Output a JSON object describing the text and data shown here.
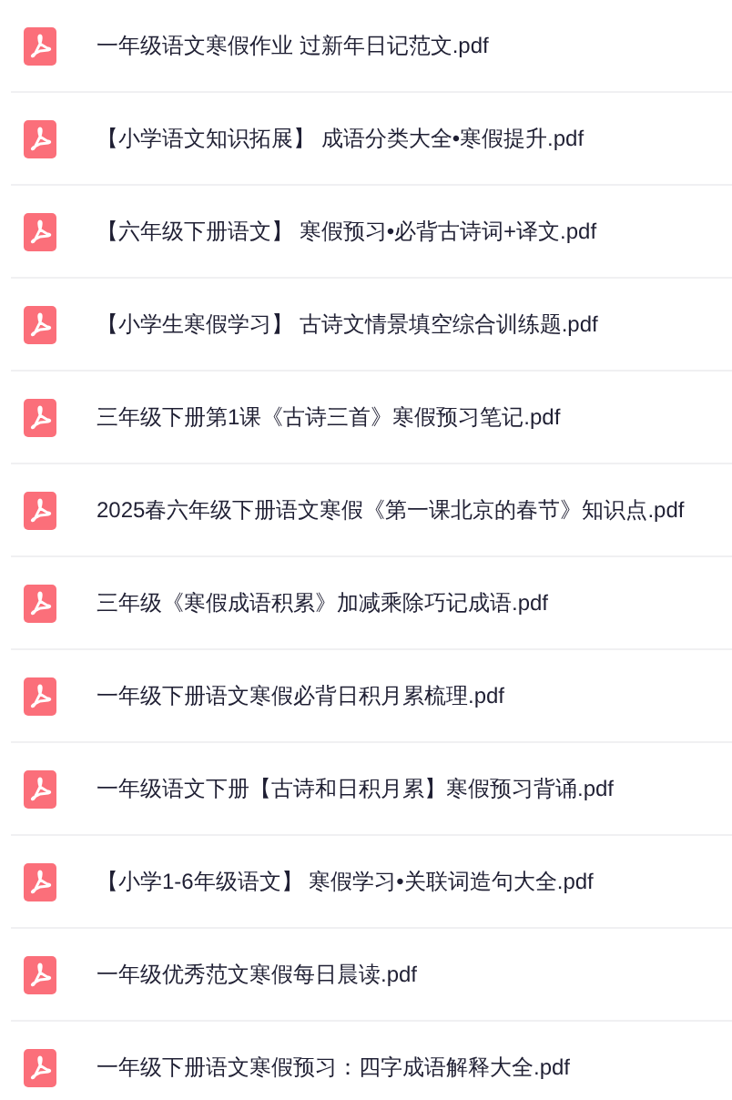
{
  "files": [
    {
      "name": "一年级语文寒假作业 过新年日记范文.pdf"
    },
    {
      "name": "【小学语文知识拓展】 成语分类大全•寒假提升.pdf"
    },
    {
      "name": "【六年级下册语文】 寒假预习•必背古诗词+译文.pdf"
    },
    {
      "name": "【小学生寒假学习】 古诗文情景填空综合训练题.pdf"
    },
    {
      "name": "三年级下册第1课《古诗三首》寒假预习笔记.pdf"
    },
    {
      "name": "2025春六年级下册语文寒假《第一课北京的春节》知识点.pdf"
    },
    {
      "name": "三年级《寒假成语积累》加减乘除巧记成语.pdf"
    },
    {
      "name": "一年级下册语文寒假必背日积月累梳理.pdf"
    },
    {
      "name": "一年级语文下册【古诗和日积月累】寒假预习背诵.pdf"
    },
    {
      "name": "【小学1-6年级语文】 寒假学习•关联词造句大全.pdf"
    },
    {
      "name": "一年级优秀范文寒假每日晨读.pdf"
    },
    {
      "name": "一年级下册语文寒假预习：四字成语解释大全.pdf"
    }
  ]
}
